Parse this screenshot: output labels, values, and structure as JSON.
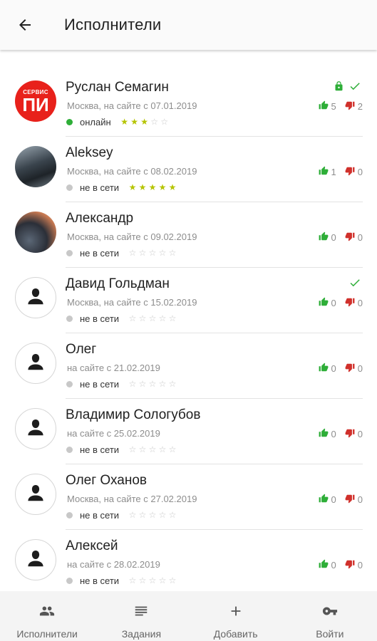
{
  "header": {
    "title": "Исполнители",
    "back_icon": "arrow-left-icon"
  },
  "colors": {
    "online": "#2eae38",
    "offline": "#c8c8c8",
    "star_filled": "#b5c400",
    "like": "#2eae38",
    "dislike": "#d0302b",
    "check": "#2eae38",
    "lock": "#2eae38"
  },
  "performers": [
    {
      "name": "Руслан Семагин",
      "meta": "Москва, на сайте с 07.01.2019",
      "status": "онлайн",
      "online": true,
      "rating": 3,
      "likes": "5",
      "dislikes": "2",
      "locked": true,
      "verified": true,
      "avatar": "logo",
      "logo_top": "СЕРВИС",
      "logo_main": "ПИ"
    },
    {
      "name": "Aleksey",
      "meta": "Москва, на сайте с 08.02.2019",
      "status": "не в сети",
      "online": false,
      "rating": 5,
      "likes": "1",
      "dislikes": "0",
      "locked": false,
      "verified": false,
      "avatar": "photo1"
    },
    {
      "name": "Александр",
      "meta": "Москва, на сайте с 09.02.2019",
      "status": "не в сети",
      "online": false,
      "rating": 0,
      "likes": "0",
      "dislikes": "0",
      "locked": false,
      "verified": false,
      "avatar": "photo2"
    },
    {
      "name": "Давид Гольдман",
      "meta": "Москва, на сайте с 15.02.2019",
      "status": "не в сети",
      "online": false,
      "rating": 0,
      "likes": "0",
      "dislikes": "0",
      "locked": false,
      "verified": true,
      "avatar": "placeholder"
    },
    {
      "name": "Олег",
      "meta": "на сайте с 21.02.2019",
      "status": "не в сети",
      "online": false,
      "rating": 0,
      "likes": "0",
      "dislikes": "0",
      "locked": false,
      "verified": false,
      "avatar": "placeholder"
    },
    {
      "name": "Владимир Сологубов",
      "meta": "на сайте с 25.02.2019",
      "status": "не в сети",
      "online": false,
      "rating": 0,
      "likes": "0",
      "dislikes": "0",
      "locked": false,
      "verified": false,
      "avatar": "placeholder"
    },
    {
      "name": "Олег Оханов",
      "meta": "Москва, на сайте с 27.02.2019",
      "status": "не в сети",
      "online": false,
      "rating": 0,
      "likes": "0",
      "dislikes": "0",
      "locked": false,
      "verified": false,
      "avatar": "placeholder"
    },
    {
      "name": "Алексей",
      "meta": "на сайте с 28.02.2019",
      "status": "не в сети",
      "online": false,
      "rating": 0,
      "likes": "0",
      "dislikes": "0",
      "locked": false,
      "verified": false,
      "avatar": "placeholder"
    }
  ],
  "bottom_nav": [
    {
      "label": "Исполнители",
      "icon": "people-icon"
    },
    {
      "label": "Задания",
      "icon": "list-icon"
    },
    {
      "label": "Добавить",
      "icon": "plus-icon"
    },
    {
      "label": "Войти",
      "icon": "key-icon"
    }
  ]
}
